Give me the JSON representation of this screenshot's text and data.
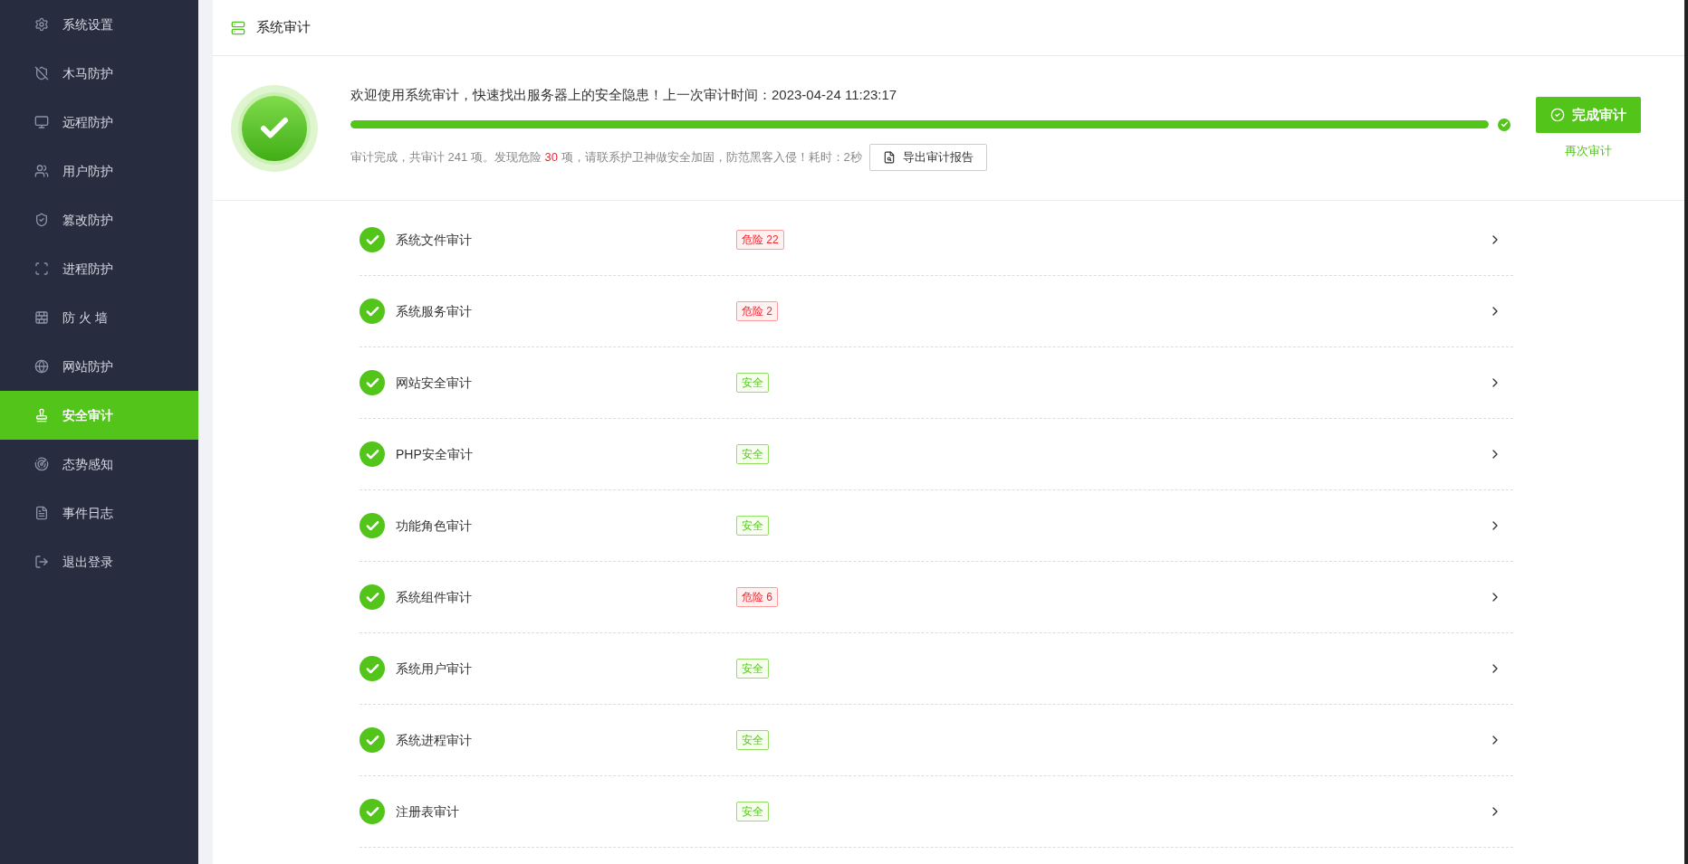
{
  "sidebar": {
    "items": [
      {
        "label": "系统设置",
        "selected": false
      },
      {
        "label": "木马防护",
        "selected": false
      },
      {
        "label": "远程防护",
        "selected": false
      },
      {
        "label": "用户防护",
        "selected": false
      },
      {
        "label": "篡改防护",
        "selected": false
      },
      {
        "label": "进程防护",
        "selected": false
      },
      {
        "label": "防 火 墙",
        "selected": false
      },
      {
        "label": "网站防护",
        "selected": false
      },
      {
        "label": "安全审计",
        "selected": true
      },
      {
        "label": "态势感知",
        "selected": false
      },
      {
        "label": "事件日志",
        "selected": false
      },
      {
        "label": "退出登录",
        "selected": false
      }
    ]
  },
  "header": {
    "title": "系统审计"
  },
  "summary": {
    "welcome": "欢迎使用系统审计，快速找出服务器上的安全隐患！上一次审计时间：2023-04-24 11:23:17",
    "progress": {
      "level": 1
    },
    "result_before": "审计完成，共审计 241 项。发现危险 ",
    "danger_count": "30",
    "result_after": " 项，请联系护卫神做安全加固，防范黑客入侵！耗时：2秒",
    "export_button": "导出审计报告",
    "finish_button": "完成审计",
    "again_link": "再次审计"
  },
  "audit_items": [
    {
      "name": "系统文件审计",
      "status": "危险 22",
      "kind": "danger"
    },
    {
      "name": "系统服务审计",
      "status": "危险 2",
      "kind": "danger"
    },
    {
      "name": "网站安全审计",
      "status": "安全",
      "kind": "safe"
    },
    {
      "name": "PHP安全审计",
      "status": "安全",
      "kind": "safe"
    },
    {
      "name": "功能角色审计",
      "status": "安全",
      "kind": "safe"
    },
    {
      "name": "系统组件审计",
      "status": "危险 6",
      "kind": "danger"
    },
    {
      "name": "系统用户审计",
      "status": "安全",
      "kind": "safe"
    },
    {
      "name": "系统进程审计",
      "status": "安全",
      "kind": "safe"
    },
    {
      "name": "注册表审计",
      "status": "安全",
      "kind": "safe"
    }
  ]
}
